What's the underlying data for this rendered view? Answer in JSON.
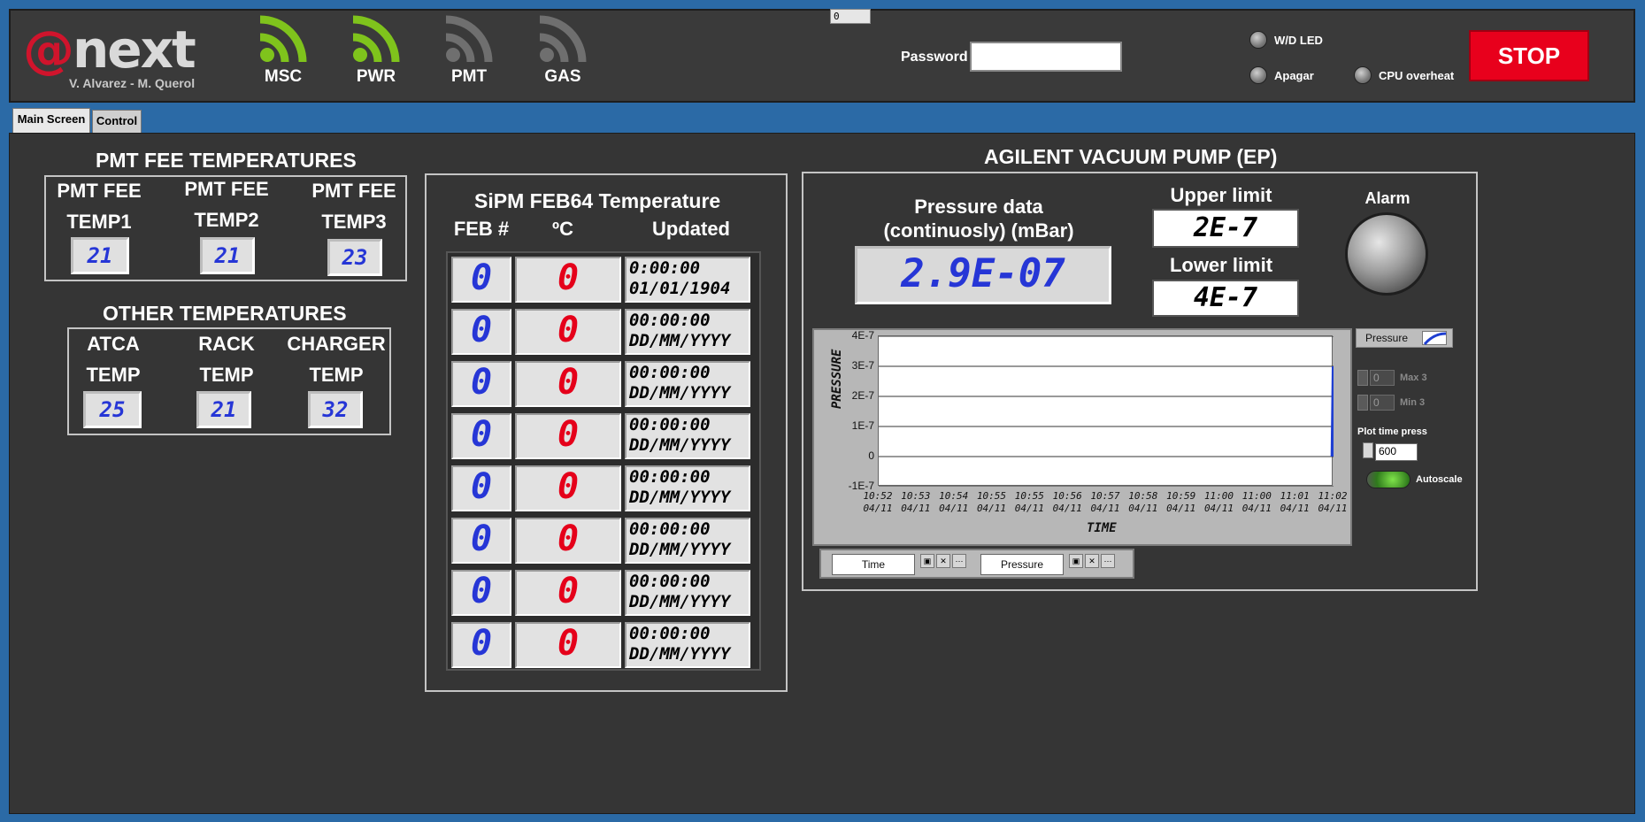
{
  "header": {
    "logo_text": "next",
    "logo_prefix": "@",
    "authors": "V. Alvarez - M. Querol",
    "indicators": [
      {
        "label": "MSC",
        "color": "#7fc31c"
      },
      {
        "label": "PWR",
        "color": "#7fc31c"
      },
      {
        "label": "PMT",
        "color": "#6f6f6f"
      },
      {
        "label": "GAS",
        "color": "#6f6f6f"
      }
    ],
    "top_mini_value": "0",
    "password_label": "Password",
    "password_value": "",
    "leds": [
      {
        "label": "W/D LED"
      },
      {
        "label": "Apagar"
      },
      {
        "label": "CPU overheat"
      }
    ],
    "stop_label": "STOP"
  },
  "tabs": [
    {
      "label": "Main Screen",
      "active": true
    },
    {
      "label": "Control",
      "active": false
    }
  ],
  "pmt_fee": {
    "title": "PMT FEE TEMPERATURES",
    "columns": [
      {
        "line1": "PMT FEE",
        "line2": "TEMP1",
        "value": "21"
      },
      {
        "line1": "PMT FEE",
        "line2": "TEMP2",
        "value": "21"
      },
      {
        "line1": "PMT FEE",
        "line2": "TEMP3",
        "value": "23"
      }
    ]
  },
  "other_temps": {
    "title": "OTHER TEMPERATURES",
    "columns": [
      {
        "line1": "ATCA",
        "line2": "TEMP",
        "value": "25"
      },
      {
        "line1": "RACK",
        "line2": "TEMP",
        "value": "21"
      },
      {
        "line1": "CHARGER",
        "line2": "TEMP",
        "value": "32"
      }
    ]
  },
  "sipm": {
    "title": "SiPM FEB64 Temperature",
    "headers": [
      "FEB #",
      "ºC",
      "Updated"
    ],
    "rows": [
      {
        "feb": "0",
        "temp": "0",
        "time": "0:00:00",
        "date": "01/01/1904"
      },
      {
        "feb": "0",
        "temp": "0",
        "time": "00:00:00",
        "date": "DD/MM/YYYY"
      },
      {
        "feb": "0",
        "temp": "0",
        "time": "00:00:00",
        "date": "DD/MM/YYYY"
      },
      {
        "feb": "0",
        "temp": "0",
        "time": "00:00:00",
        "date": "DD/MM/YYYY"
      },
      {
        "feb": "0",
        "temp": "0",
        "time": "00:00:00",
        "date": "DD/MM/YYYY"
      },
      {
        "feb": "0",
        "temp": "0",
        "time": "00:00:00",
        "date": "DD/MM/YYYY"
      },
      {
        "feb": "0",
        "temp": "0",
        "time": "00:00:00",
        "date": "DD/MM/YYYY"
      },
      {
        "feb": "0",
        "temp": "0",
        "time": "00:00:00",
        "date": "DD/MM/YYYY"
      }
    ]
  },
  "vacuum": {
    "title": "AGILENT VACUUM PUMP (EP)",
    "pressure_label_1": "Pressure data",
    "pressure_label_2": "(continuosly) (mBar)",
    "pressure_value": "2.9E-07",
    "upper_label": "Upper limit",
    "upper_value": "2E-7",
    "lower_label": "Lower limit",
    "lower_value": "4E-7",
    "alarm_label": "Alarm",
    "legend_label": "Pressure",
    "max_value": "0",
    "max_label": "Max 3",
    "min_value": "0",
    "min_label": "Min 3",
    "plot_time_label": "Plot time press",
    "plot_time_value": "600",
    "autoscale_label": "Autoscale",
    "cursor_time": "Time",
    "cursor_pressure": "Pressure"
  },
  "chart_data": {
    "type": "line",
    "ylabel": "PRESSURE",
    "xlabel": "TIME",
    "y_ticks": [
      "4E-7",
      "3E-7",
      "2E-7",
      "1E-7",
      "0",
      "-1E-7"
    ],
    "y_tick_values": [
      4e-07,
      3e-07,
      2e-07,
      1e-07,
      0,
      -1e-07
    ],
    "ylim": [
      -1e-07,
      4e-07
    ],
    "x_ticks": [
      {
        "time": "10:52",
        "date": "04/11"
      },
      {
        "time": "10:53",
        "date": "04/11"
      },
      {
        "time": "10:54",
        "date": "04/11"
      },
      {
        "time": "10:55",
        "date": "04/11"
      },
      {
        "time": "10:55",
        "date": "04/11"
      },
      {
        "time": "10:56",
        "date": "04/11"
      },
      {
        "time": "10:57",
        "date": "04/11"
      },
      {
        "time": "10:58",
        "date": "04/11"
      },
      {
        "time": "10:59",
        "date": "04/11"
      },
      {
        "time": "11:00",
        "date": "04/11"
      },
      {
        "time": "11:00",
        "date": "04/11"
      },
      {
        "time": "11:01",
        "date": "04/11"
      },
      {
        "time": "11:02",
        "date": "04/11"
      }
    ],
    "series": [
      {
        "name": "Pressure",
        "color": "#1f3fd1",
        "x": [
          11.97,
          12.0
        ],
        "y": [
          0,
          3e-07
        ]
      }
    ],
    "grid": true
  }
}
